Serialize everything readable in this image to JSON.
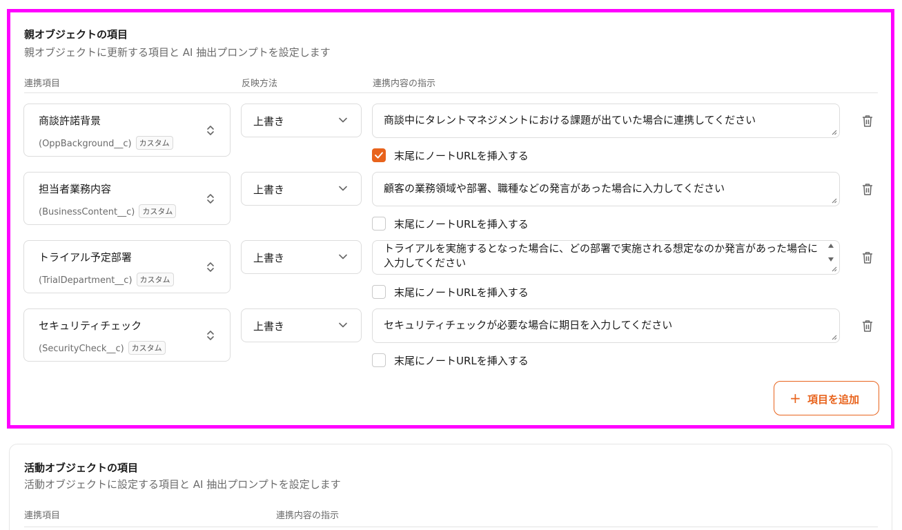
{
  "parent_section": {
    "title": "親オブジェクトの項目",
    "subtitle": "親オブジェクトに更新する項目と AI 抽出プロンプトを設定します",
    "columns": {
      "field": "連携項目",
      "method": "反映方法",
      "instruction": "連携内容の指示"
    },
    "checkbox_label": "末尾にノートURLを挿入する",
    "rows": [
      {
        "name": "商談許諾背景",
        "api": "(OppBackground__c)",
        "badge": "カスタム",
        "method": "上書き",
        "instruction": "商談中にタレントマネジメントにおける課題が出ていた場合に連携してください",
        "append_url": true
      },
      {
        "name": "担当者業務内容",
        "api": "(BusinessContent__c)",
        "badge": "カスタム",
        "method": "上書き",
        "instruction": "顧客の業務領域や部署、職種などの発言があった場合に入力してください",
        "append_url": false
      },
      {
        "name": "トライアル予定部署",
        "api": "(TrialDepartment__c)",
        "badge": "カスタム",
        "method": "上書き",
        "instruction": "トライアルを実施するとなった場合に、どの部署で実施される想定なのか発言があった場合に入力してください",
        "append_url": false
      },
      {
        "name": "セキュリティチェック",
        "api": "(SecurityCheck__c)",
        "badge": "カスタム",
        "method": "上書き",
        "instruction": "セキュリティチェックが必要な場合に期日を入力してください",
        "append_url": false
      }
    ],
    "add_button_label": "項目を追加",
    "accent_color": "#e8631c",
    "highlight_color": "#ff00ff"
  },
  "activity_section": {
    "title": "活動オブジェクトの項目",
    "subtitle": "活動オブジェクトに設定する項目と AI 抽出プロンプトを設定します",
    "columns": {
      "field": "連携項目",
      "instruction": "連携内容の指示"
    }
  }
}
